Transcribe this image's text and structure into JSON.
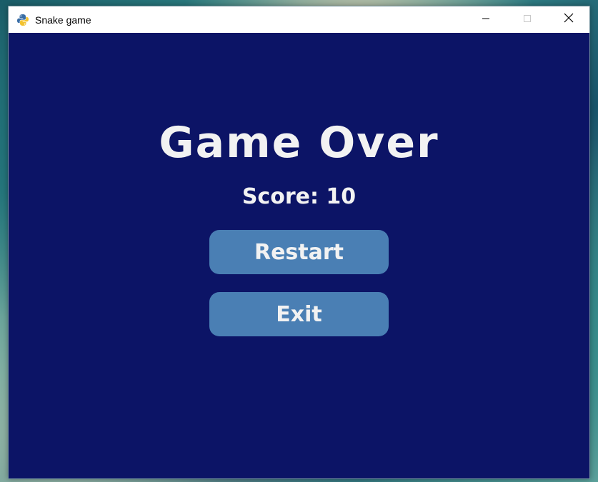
{
  "window": {
    "title": "Snake game",
    "app_icon": "python-icon",
    "controls": {
      "minimize_icon": "minimize-icon",
      "maximize_icon": "maximize-icon",
      "close_icon": "close-icon"
    }
  },
  "game": {
    "heading": "Game Over",
    "score_text": "Score: 10",
    "restart_label": "Restart",
    "exit_label": "Exit"
  },
  "colors": {
    "background": "#0c1466",
    "button": "#4a7fb4",
    "text": "#f2f2f2",
    "titlebar": "#ffffff"
  }
}
